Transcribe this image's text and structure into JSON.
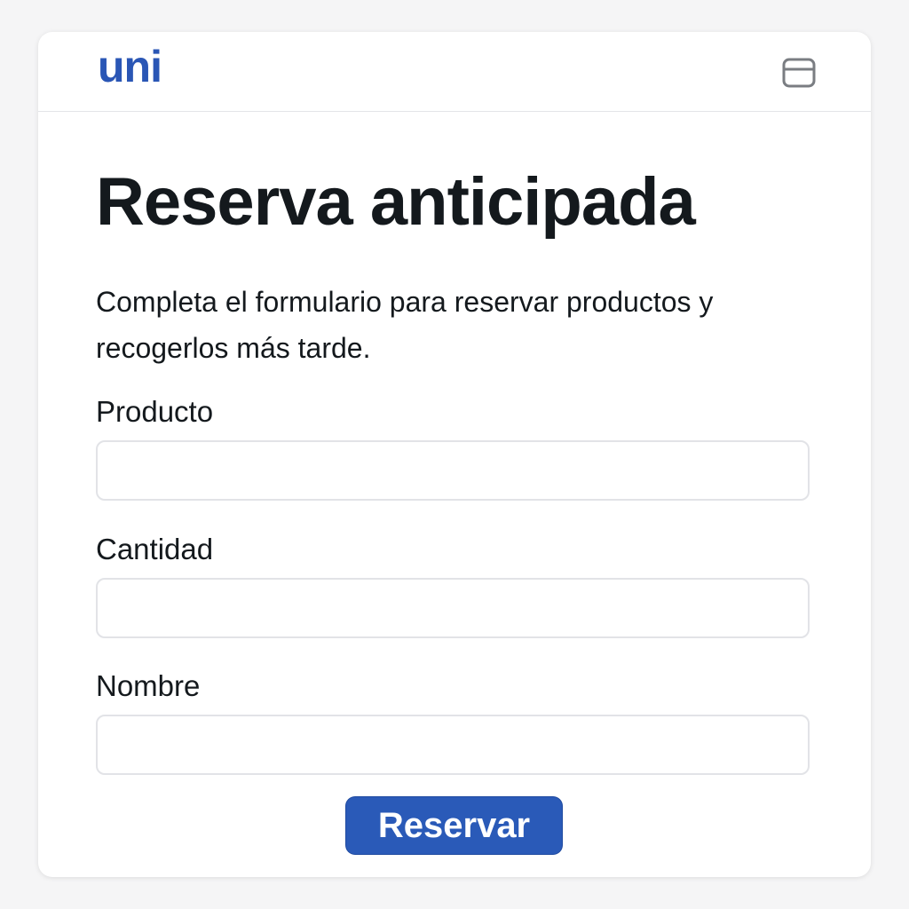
{
  "brand": {
    "logo_text": "uni",
    "accent_color": "#2a56b5"
  },
  "header": {
    "menu_icon": "card-window-icon"
  },
  "form": {
    "title": "Reserva anticipada",
    "description": "Completa el formulario para reservar productos y recogerlos más tarde.",
    "fields": [
      {
        "label": "Producto",
        "value": "",
        "placeholder": ""
      },
      {
        "label": "Cantidad",
        "value": "",
        "placeholder": ""
      },
      {
        "label": "Nombre",
        "value": "",
        "placeholder": ""
      }
    ],
    "submit_label": "Reservar",
    "submit_color": "#2a5ab8"
  }
}
